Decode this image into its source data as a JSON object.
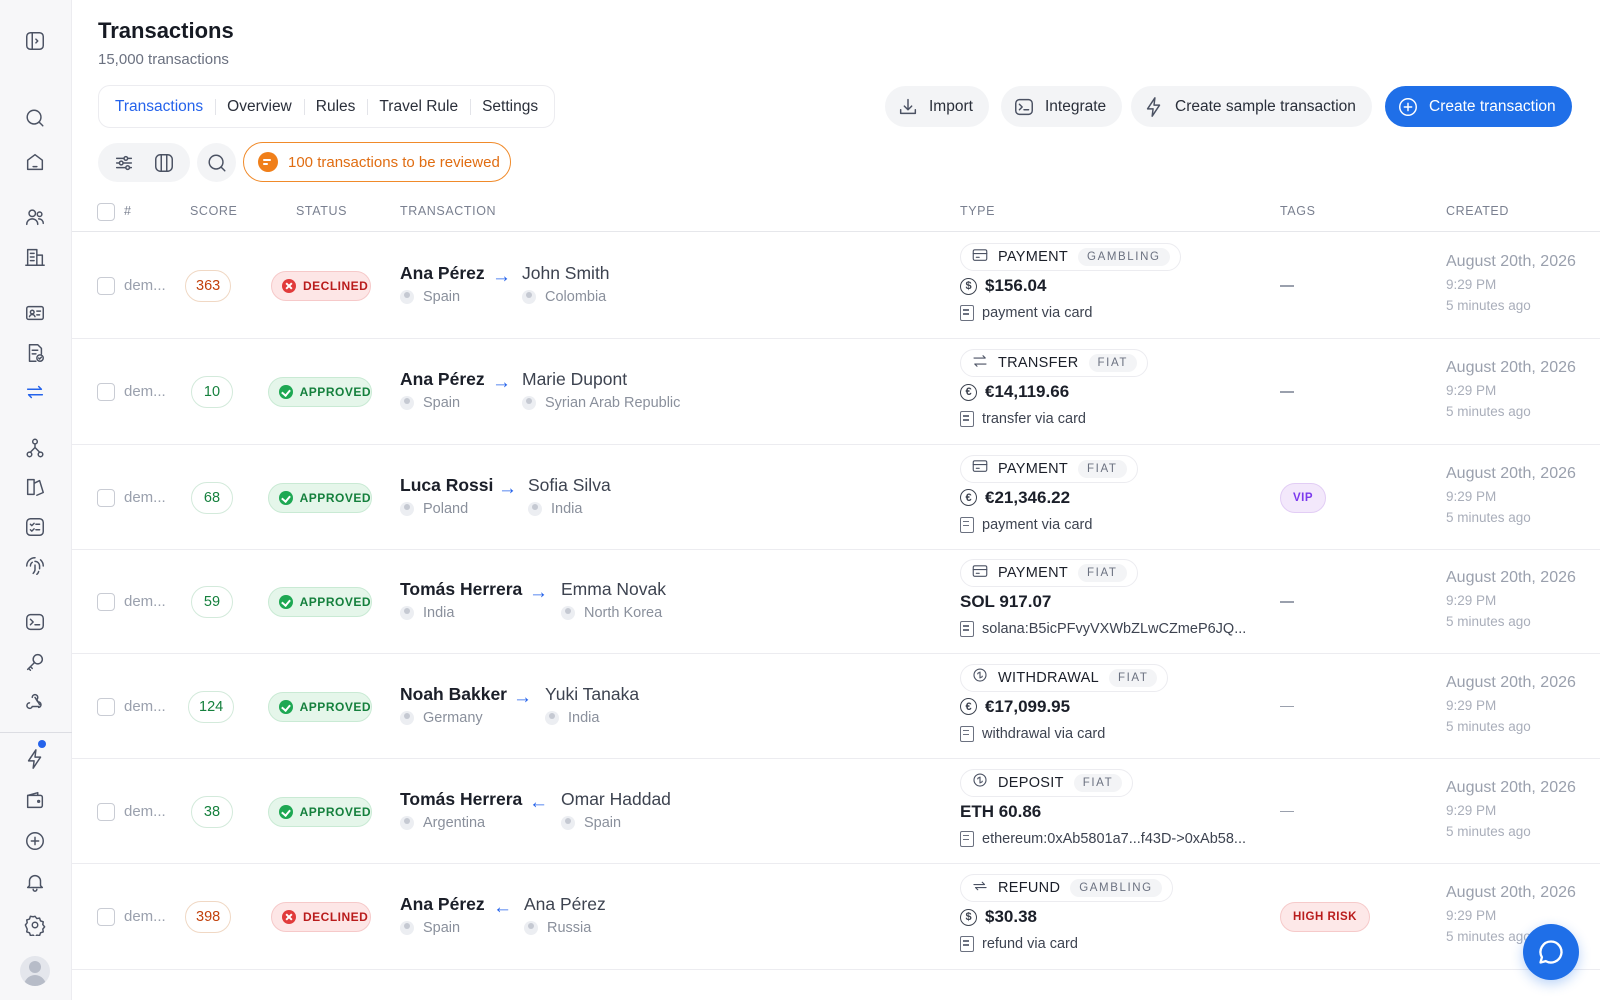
{
  "header": {
    "title": "Transactions",
    "subtitle": "15,000 transactions"
  },
  "tabs": [
    {
      "label": "Transactions",
      "active": true
    },
    {
      "label": "Overview"
    },
    {
      "label": "Rules"
    },
    {
      "label": "Travel Rule"
    },
    {
      "label": "Settings"
    }
  ],
  "actions": {
    "import": "Import",
    "integrate": "Integrate",
    "sample": "Create sample transaction",
    "create": "Create transaction"
  },
  "toolbar": {
    "review_label": "100 transactions to be reviewed"
  },
  "columns": {
    "id": "#",
    "score": "SCORE",
    "status": "STATUS",
    "transaction": "TRANSACTION",
    "type": "TYPE",
    "tags": "TAGS",
    "created": "CREATED"
  },
  "colors": {
    "accent": "#1f6fe8",
    "declined": "#e13b3b",
    "approved": "#1ea853",
    "review": "#f07f1a"
  },
  "rows": [
    {
      "id": "dem...",
      "score": "363",
      "status": "DECLINED",
      "from": "Ana Pérez",
      "from_country": "Spain",
      "arrow": "→",
      "to": "John Smith",
      "to_country": "Colombia",
      "type": "PAYMENT",
      "category": "GAMBLING",
      "currency_icon": "dollar",
      "currency_symbol": "$",
      "amount": "$156.04",
      "description": "payment via card",
      "tag": "",
      "date": "August 20th, 2026",
      "time": "9:29 PM",
      "relative": "5 minutes ago"
    },
    {
      "id": "dem...",
      "score": "10",
      "status": "APPROVED",
      "from": "Ana Pérez",
      "from_country": "Spain",
      "arrow": "→",
      "to": "Marie Dupont",
      "to_country": "Syrian Arab Republic",
      "type": "TRANSFER",
      "category": "FIAT",
      "currency_icon": "euro",
      "currency_symbol": "€",
      "amount": "€14,119.66",
      "description": "transfer via card",
      "tag": "",
      "date": "August 20th, 2026",
      "time": "9:29 PM",
      "relative": "5 minutes ago"
    },
    {
      "id": "dem...",
      "score": "68",
      "status": "APPROVED",
      "from": "Luca Rossi",
      "from_country": "Poland",
      "arrow": "→",
      "to": "Sofia Silva",
      "to_country": "India",
      "type": "PAYMENT",
      "category": "FIAT",
      "currency_icon": "euro",
      "currency_symbol": "€",
      "amount": "€21,346.22",
      "description": "payment via card",
      "tag": "VIP",
      "date": "August 20th, 2026",
      "time": "9:29 PM",
      "relative": "5 minutes ago"
    },
    {
      "id": "dem...",
      "score": "59",
      "status": "APPROVED",
      "from": "Tomás Herrera",
      "from_country": "India",
      "arrow": "→",
      "to": "Emma Novak",
      "to_country": "North Korea",
      "type": "PAYMENT",
      "category": "FIAT",
      "currency_icon": "",
      "currency_symbol": "",
      "amount": "SOL 917.07",
      "description": "solana:B5icPFvyVXWbZLwCZmeP6JQ...",
      "tag": "",
      "date": "August 20th, 2026",
      "time": "9:29 PM",
      "relative": "5 minutes ago"
    },
    {
      "id": "dem...",
      "score": "124",
      "status": "APPROVED",
      "from": "Noah Bakker",
      "from_country": "Germany",
      "arrow": "→",
      "to": "Yuki Tanaka",
      "to_country": "India",
      "type": "WITHDRAWAL",
      "category": "FIAT",
      "currency_icon": "euro",
      "currency_symbol": "€",
      "amount": "€17,099.95",
      "description": "withdrawal via card",
      "tag": "",
      "date": "August 20th, 2026",
      "time": "9:29 PM",
      "relative": "5 minutes ago"
    },
    {
      "id": "dem...",
      "score": "38",
      "status": "APPROVED",
      "from": "Tomás Herrera",
      "from_country": "Argentina",
      "arrow": "←",
      "to": "Omar Haddad",
      "to_country": "Spain",
      "type": "DEPOSIT",
      "category": "FIAT",
      "currency_icon": "",
      "currency_symbol": "",
      "amount": "ETH 60.86",
      "description": "ethereum:0xAb5801a7...f43D->0xAb58...",
      "tag": "",
      "date": "August 20th, 2026",
      "time": "9:29 PM",
      "relative": "5 minutes ago"
    },
    {
      "id": "dem...",
      "score": "398",
      "status": "DECLINED",
      "from": "Ana Pérez",
      "from_country": "Spain",
      "arrow": "←",
      "to": "Ana Pérez",
      "to_country": "Russia",
      "type": "REFUND",
      "category": "GAMBLING",
      "currency_icon": "dollar",
      "currency_symbol": "$",
      "amount": "$30.38",
      "description": "refund via card",
      "tag": "HIGH RISK",
      "date": "August 20th, 2026",
      "time": "9:29 PM",
      "relative": "5 minutes ago"
    }
  ]
}
